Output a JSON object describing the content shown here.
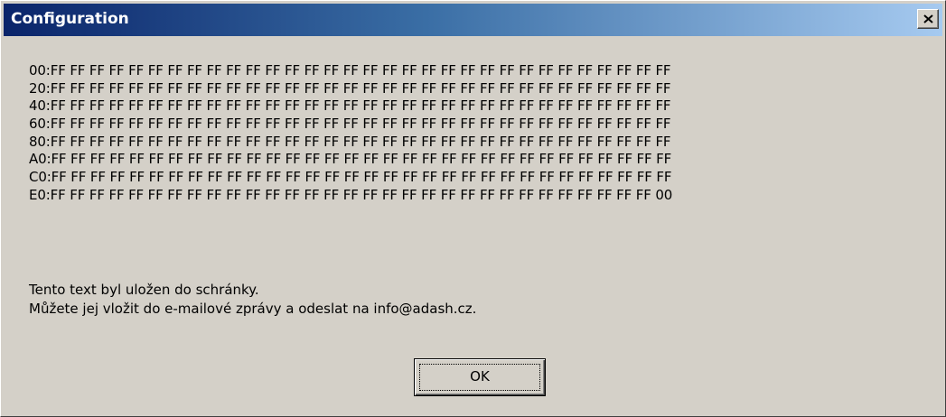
{
  "window": {
    "title": "Configuration",
    "close_icon": "close-icon"
  },
  "dump": {
    "lines": [
      "00:FF FF FF FF FF FF FF FF FF FF FF FF FF FF FF FF FF FF FF FF FF FF FF FF FF FF FF FF FF FF FF FF",
      "20:FF FF FF FF FF FF FF FF FF FF FF FF FF FF FF FF FF FF FF FF FF FF FF FF FF FF FF FF FF FF FF FF",
      "40:FF FF FF FF FF FF FF FF FF FF FF FF FF FF FF FF FF FF FF FF FF FF FF FF FF FF FF FF FF FF FF FF",
      "60:FF FF FF FF FF FF FF FF FF FF FF FF FF FF FF FF FF FF FF FF FF FF FF FF FF FF FF FF FF FF FF FF",
      "80:FF FF FF FF FF FF FF FF FF FF FF FF FF FF FF FF FF FF FF FF FF FF FF FF FF FF FF FF FF FF FF FF",
      "A0:FF FF FF FF FF FF FF FF FF FF FF FF FF FF FF FF FF FF FF FF FF FF FF FF FF FF FF FF FF FF FF FF",
      "C0:FF FF FF FF FF FF FF FF FF FF FF FF FF FF FF FF FF FF FF FF FF FF FF FF FF FF FF FF FF FF FF FF",
      "E0:FF FF FF FF FF FF FF FF FF FF FF FF FF FF FF FF FF FF FF FF FF FF FF FF FF FF FF FF FF FF FF 00"
    ]
  },
  "message": {
    "line1": "Tento text byl uložen do schránky.",
    "line2": "Můžete jej vložit do e-mailové zprávy a odeslat na info@adash.cz."
  },
  "buttons": {
    "ok_label": "OK"
  }
}
